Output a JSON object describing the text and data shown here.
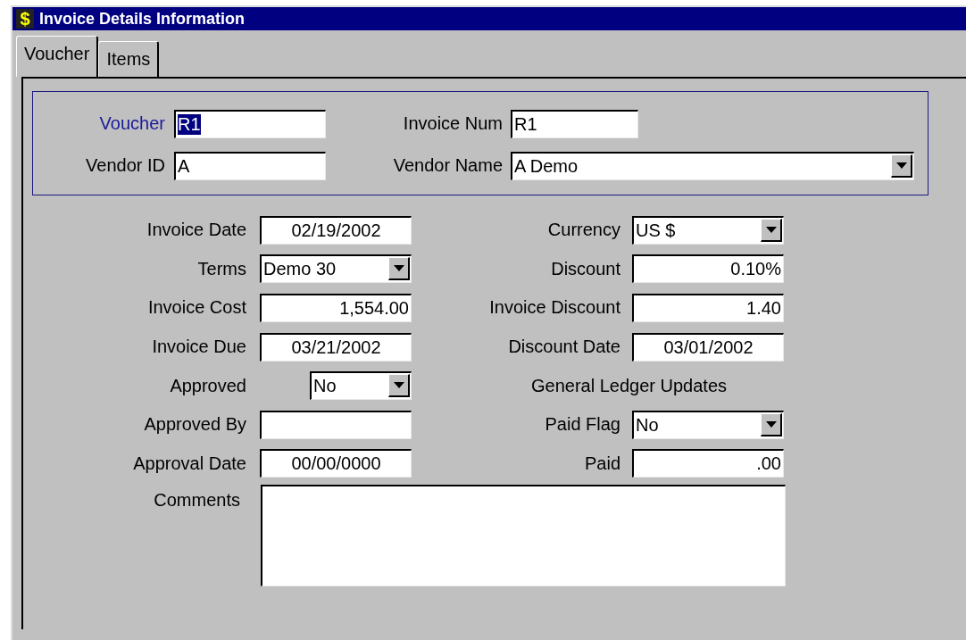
{
  "window": {
    "icon_glyph": "$",
    "title": "Invoice Details Information"
  },
  "tabs": [
    {
      "label": "Voucher",
      "selected": true
    },
    {
      "label": "Items",
      "selected": false
    }
  ],
  "header": {
    "rows": [
      {
        "left": {
          "label": "Voucher",
          "value": "R1",
          "kind": "text",
          "focused": true
        },
        "right": {
          "label": "Invoice Num",
          "value": "R1",
          "kind": "text",
          "focused": false
        }
      },
      {
        "left": {
          "label": "Vendor ID",
          "value": "A",
          "kind": "text",
          "focused": false
        },
        "right": {
          "label": "Vendor Name",
          "value": "A Demo",
          "kind": "dropdown",
          "focused": false
        }
      }
    ]
  },
  "rows": [
    {
      "left": {
        "label": "Invoice Date",
        "value": "02/19/2002",
        "kind": "date"
      },
      "right": {
        "kind": "dropdown",
        "label": "Currency",
        "value": "US $"
      }
    },
    {
      "left": {
        "label": "Terms",
        "value": "Demo 30",
        "kind": "dropdown"
      },
      "right": {
        "kind": "amount",
        "label": "Discount",
        "value": "0.10%"
      }
    },
    {
      "left": {
        "label": "Invoice Cost",
        "value": "1,554.00",
        "kind": "amount"
      },
      "right": {
        "kind": "amount",
        "label": "Invoice Discount",
        "value": "1.40"
      }
    },
    {
      "left": {
        "label": "Invoice Due",
        "value": "03/21/2002",
        "kind": "date"
      },
      "right": {
        "kind": "date",
        "label": "Discount Date",
        "value": "03/01/2002"
      }
    },
    {
      "left": {
        "label": "Approved",
        "value": "No",
        "kind": "small-dropdown"
      },
      "right": {
        "kind": "heading",
        "label": "General Ledger Updates"
      }
    },
    {
      "left": {
        "label": "Approved By",
        "kind": "text"
      },
      "right": {
        "kind": "dropdown",
        "label": "Paid Flag",
        "value": "No"
      }
    },
    {
      "left": {
        "label": "Approval Date",
        "value": "00/00/0000",
        "kind": "date"
      },
      "right": {
        "kind": "amount",
        "label": "Paid",
        "value": ".00"
      }
    }
  ],
  "comments": {
    "label": "Comments"
  }
}
